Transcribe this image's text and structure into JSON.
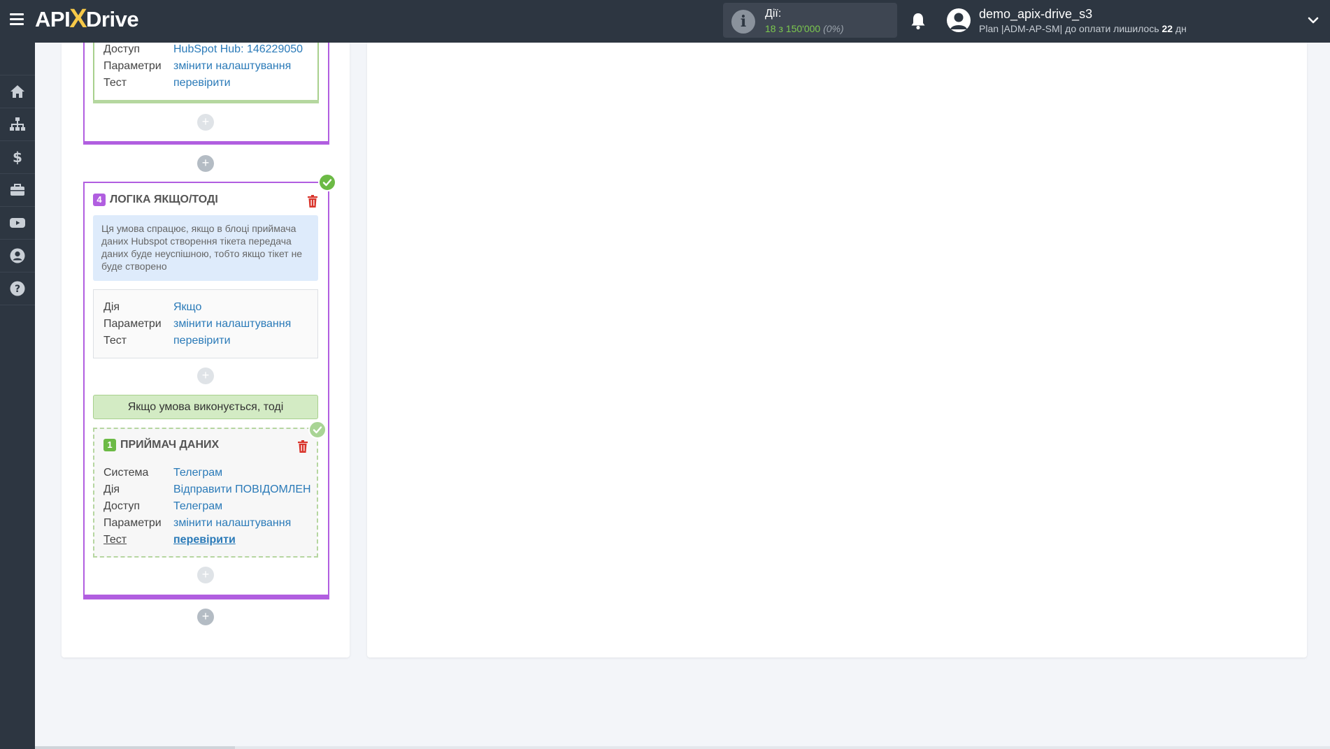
{
  "app": {
    "logo_left": "API",
    "logo_x": "X",
    "logo_right": "Drive"
  },
  "header": {
    "actions_label": "Дії:",
    "actions_used": "18",
    "actions_sep": "з",
    "actions_total": "150'000",
    "actions_pct": "(0%)",
    "user_name": "demo_apix-drive_s3",
    "plan_prefix": "Plan |ADM-AP-SM| до оплати лишилось",
    "plan_days": "22",
    "plan_days_unit": "дн"
  },
  "top_block": {
    "rows": [
      {
        "key": "Доступ",
        "value": "HubSpot Hub: 146229050"
      },
      {
        "key": "Параметри",
        "value": "змінити налаштування"
      },
      {
        "key": "Тест",
        "value": "перевірити"
      }
    ]
  },
  "logic_block": {
    "number": "4",
    "title": "ЛОГІКА ЯКЩО/ТОДІ",
    "note": "Ця умова спрацює, якщо в блоці приймача даних Hubspot створення тікета передача даних буде неуспішною, тобто якщо тікет не буде створено",
    "rows": [
      {
        "key": "Дія",
        "value": "Якщо"
      },
      {
        "key": "Параметри",
        "value": "змінити налаштування"
      },
      {
        "key": "Тест",
        "value": "перевірити"
      }
    ],
    "condition_label": "Якщо умова виконується, тоді"
  },
  "receiver_block": {
    "number": "1",
    "title": "ПРИЙМАЧ ДАНИХ",
    "rows": [
      {
        "key": "Система",
        "value": "Телеграм"
      },
      {
        "key": "Дія",
        "value": "Відправити ПОВІДОМЛЕН"
      },
      {
        "key": "Доступ",
        "value": "Телеграм"
      },
      {
        "key": "Параметри",
        "value": "змінити налаштування"
      },
      {
        "key": "Тест",
        "value": "перевірити"
      }
    ]
  },
  "colors": {
    "topbar": "#2d3641",
    "purple": "#b15ee0",
    "green": "#6cba45",
    "link": "#2a7ab8",
    "trash": "#d9342b"
  },
  "icons": {
    "sidebar": [
      "home-icon",
      "sitemap-icon",
      "dollar-icon",
      "briefcase-icon",
      "youtube-icon",
      "user-circle-icon",
      "question-icon"
    ]
  }
}
